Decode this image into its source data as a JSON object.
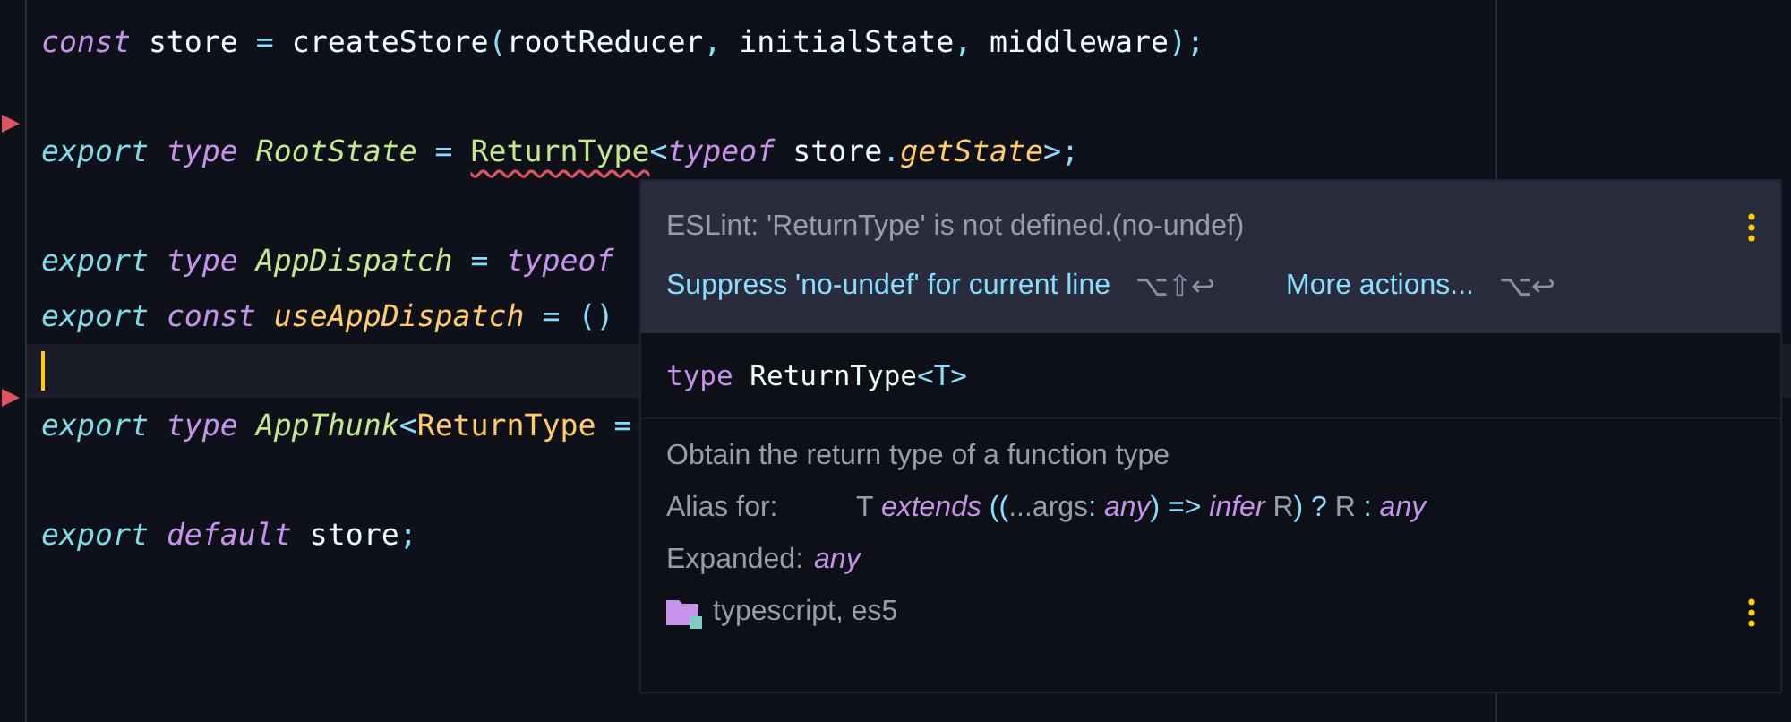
{
  "editor": {
    "lines": [
      {
        "marker": false,
        "current": false,
        "tokens": [
          {
            "text": "const",
            "kind": "storage"
          },
          {
            "text": " store ",
            "kind": "plain"
          },
          {
            "text": "=",
            "kind": "punct"
          },
          {
            "text": " createStore",
            "kind": "plain"
          },
          {
            "text": "(",
            "kind": "punct"
          },
          {
            "text": "rootReducer",
            "kind": "plain"
          },
          {
            "text": ",",
            "kind": "punct"
          },
          {
            "text": " initialState",
            "kind": "plain"
          },
          {
            "text": ",",
            "kind": "punct"
          },
          {
            "text": " middleware",
            "kind": "plain"
          },
          {
            "text": ");",
            "kind": "punct"
          }
        ]
      },
      {
        "marker": false,
        "current": false
      },
      {
        "marker": true,
        "current": false,
        "tokens": [
          {
            "text": "export ",
            "kind": "keyword"
          },
          {
            "text": "type ",
            "kind": "storage"
          },
          {
            "text": "RootState",
            "kind": "type"
          },
          {
            "text": " = ",
            "kind": "punct"
          },
          {
            "text": "ReturnType",
            "kind": "error"
          },
          {
            "text": "<",
            "kind": "punct"
          },
          {
            "text": "typeof",
            "kind": "storage"
          },
          {
            "text": " store",
            "kind": "plain"
          },
          {
            "text": ".",
            "kind": "punct"
          },
          {
            "text": "getState",
            "kind": "func"
          },
          {
            "text": ">;",
            "kind": "punct"
          }
        ]
      },
      {
        "marker": false,
        "current": false
      },
      {
        "marker": false,
        "current": false,
        "tokens": [
          {
            "text": "export ",
            "kind": "keyword"
          },
          {
            "text": "type ",
            "kind": "storage"
          },
          {
            "text": "AppDispatch",
            "kind": "type"
          },
          {
            "text": " = ",
            "kind": "punct"
          },
          {
            "text": "typeof",
            "kind": "storage"
          }
        ]
      },
      {
        "marker": false,
        "current": false,
        "tokens": [
          {
            "text": "export ",
            "kind": "keyword"
          },
          {
            "text": "const ",
            "kind": "storage"
          },
          {
            "text": "useAppDispatch",
            "kind": "func"
          },
          {
            "text": " = ()",
            "kind": "punct"
          }
        ]
      },
      {
        "marker": false,
        "current": true
      },
      {
        "marker": true,
        "current": false,
        "tokens": [
          {
            "text": "export ",
            "kind": "keyword"
          },
          {
            "text": "type ",
            "kind": "storage"
          },
          {
            "text": "AppThunk",
            "kind": "type"
          },
          {
            "text": "<",
            "kind": "punct"
          },
          {
            "text": "ReturnType",
            "kind": "param"
          },
          {
            "text": " =",
            "kind": "punct"
          }
        ]
      },
      {
        "marker": false,
        "current": false
      },
      {
        "marker": false,
        "current": false,
        "tokens": [
          {
            "text": "export ",
            "kind": "keyword"
          },
          {
            "text": "default",
            "kind": "storage"
          },
          {
            "text": " store",
            "kind": "plain"
          },
          {
            "text": ";",
            "kind": "punct"
          }
        ]
      }
    ]
  },
  "popup": {
    "message": "ESLint: 'ReturnType' is not defined.(no-undef)",
    "actions": [
      {
        "label": "Suppress 'no-undef' for current line",
        "shortcut": "⌥⇧↩"
      },
      {
        "label": "More actions...",
        "shortcut": "⌥↩"
      }
    ],
    "signature": [
      {
        "text": "type",
        "kind": "storage"
      },
      {
        "text": " ReturnType",
        "kind": "plain"
      },
      {
        "text": "<T>",
        "kind": "punct"
      }
    ],
    "description": "Obtain the return type of a function type",
    "rows": [
      {
        "label": "Alias for:",
        "tokens": [
          {
            "text": "T ",
            "kind": "plain"
          },
          {
            "text": "extends",
            "kind": "storage"
          },
          {
            "text": " ((",
            "kind": "punct"
          },
          {
            "text": "...args",
            "kind": "plain"
          },
          {
            "text": ": ",
            "kind": "punct"
          },
          {
            "text": "any",
            "kind": "storage"
          },
          {
            "text": ") => ",
            "kind": "punct"
          },
          {
            "text": "infer",
            "kind": "storage"
          },
          {
            "text": " R",
            "kind": "plain"
          },
          {
            "text": ") ? ",
            "kind": "punct"
          },
          {
            "text": "R ",
            "kind": "plain"
          },
          {
            "text": ": ",
            "kind": "punct"
          },
          {
            "text": "any",
            "kind": "storage"
          }
        ]
      },
      {
        "label": "Expanded:",
        "tokens": [
          {
            "text": "any",
            "kind": "storage"
          }
        ]
      }
    ],
    "source": "typescript, es5"
  }
}
